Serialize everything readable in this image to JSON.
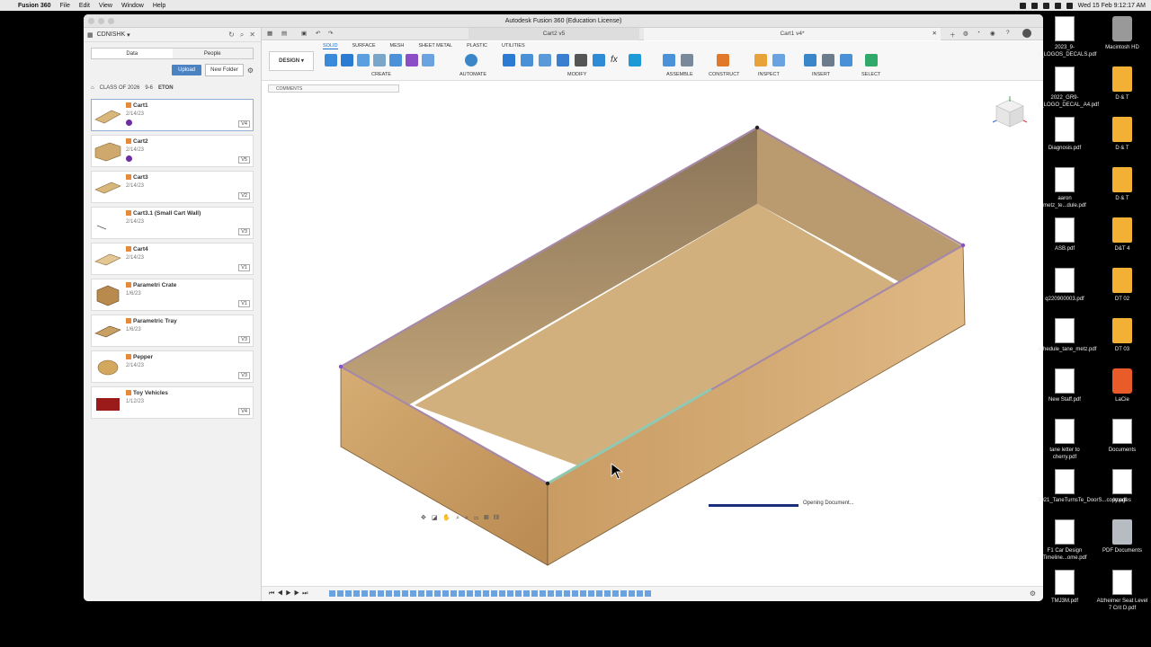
{
  "menubar": {
    "app": "Fusion 360",
    "items": [
      "File",
      "Edit",
      "View",
      "Window",
      "Help"
    ],
    "clock": "Wed 15 Feb  9:12:17 AM"
  },
  "window": {
    "title": "Autodesk Fusion 360 (Education License)"
  },
  "data_panel": {
    "user": "CDNISHK",
    "tabs": [
      "Data",
      "People"
    ],
    "upload": "Upload",
    "new_folder": "New Folder",
    "breadcrumbs": [
      "CLASS OF 2026",
      "9-6",
      "ETON"
    ],
    "files": [
      {
        "name": "Cart1",
        "date": "2/14/23",
        "version": "V4"
      },
      {
        "name": "Cart2",
        "date": "2/14/23",
        "version": "V5"
      },
      {
        "name": "Cart3",
        "date": "2/14/23",
        "version": "V2"
      },
      {
        "name": "Cart3.1 (Small Cart Wall)",
        "date": "2/14/23",
        "version": "V3"
      },
      {
        "name": "Cart4",
        "date": "2/14/23",
        "version": "V1"
      },
      {
        "name": "Parametri Crate",
        "date": "1/6/23",
        "version": "V1"
      },
      {
        "name": "Parametric Tray",
        "date": "1/6/23",
        "version": "V3"
      },
      {
        "name": "Pepper",
        "date": "2/14/23",
        "version": "V3"
      },
      {
        "name": "Toy Vehicles",
        "date": "1/12/23",
        "version": "V4"
      }
    ]
  },
  "doc_tabs": {
    "tab2": "Cart2 v5",
    "tab1": "Cart1 v4*"
  },
  "ribbon": {
    "workspace": "DESIGN",
    "tabs": [
      "SOLID",
      "SURFACE",
      "MESH",
      "SHEET METAL",
      "PLASTIC",
      "UTILITIES"
    ],
    "groups": [
      "CREATE",
      "AUTOMATE",
      "MODIFY",
      "ASSEMBLE",
      "CONSTRUCT",
      "INSPECT",
      "INSERT",
      "SELECT"
    ]
  },
  "comments": "COMMENTS",
  "status": {
    "opening": "Opening Document..."
  },
  "desktop": [
    {
      "label": "2023_9-1_LOGOS_DECALS.pdf"
    },
    {
      "label": "Macintosh HD"
    },
    {
      "label": "2022_GR9-1_LOGO_DECAL_A4.pdf"
    },
    {
      "label": "D & T"
    },
    {
      "label": "Diagnosis.pdf"
    },
    {
      "label": "D & T"
    },
    {
      "label": "aaron metz_te...dule.pdf"
    },
    {
      "label": "D & T"
    },
    {
      "label": "ASB.pdf"
    },
    {
      "label": "D&T 4"
    },
    {
      "label": "q220900003.pdf"
    },
    {
      "label": "DT 02"
    },
    {
      "label": "schedule_tane_metz.pdf"
    },
    {
      "label": "DT 03"
    },
    {
      "label": "New Staff.pdf"
    },
    {
      "label": "LaCie"
    },
    {
      "label": "tane letter to cherry.pdf"
    },
    {
      "label": "Documents"
    },
    {
      "label": "2021_TaneTurnsTe_DoorS...copy.pdf"
    },
    {
      "label": "Images"
    },
    {
      "label": "F1 Car Design Timeline...ome.pdf"
    },
    {
      "label": "PDF Documents"
    },
    {
      "label": "TMJ3M.pdf"
    },
    {
      "label": "Alzheimer Seat Level 7 Crit D.pdf"
    }
  ]
}
